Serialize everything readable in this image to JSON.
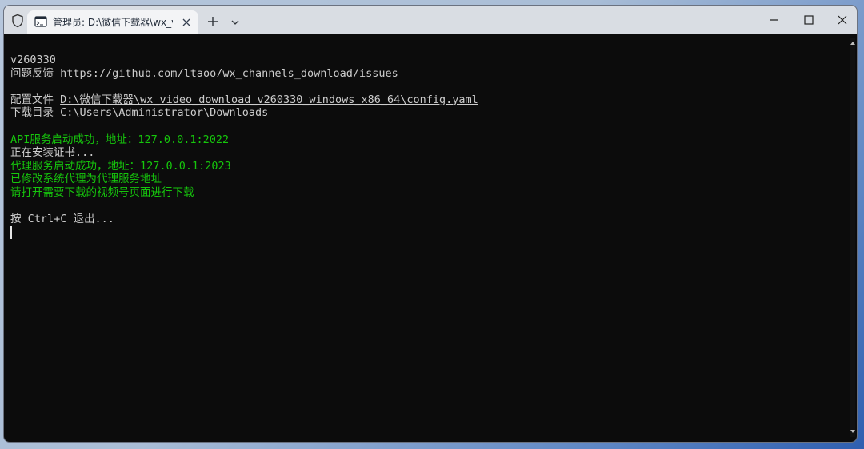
{
  "window": {
    "tab_title": "管理员: D:\\微信下载器\\wx_video",
    "new_tab_symbol": "+",
    "minimize_symbol": "—",
    "maximize_symbol": "▢",
    "close_symbol": "×"
  },
  "console": {
    "version": "v260330",
    "feedback_label": "问题反馈",
    "feedback_url": "https://github.com/ltaoo/wx_channels_download/issues",
    "config_label": "配置文件",
    "config_path": "D:\\微信下载器\\wx_video_download_v260330_windows_x86_64\\config.yaml",
    "download_label": "下载目录",
    "download_path": "C:\\Users\\Administrator\\Downloads",
    "api_started": "API服务启动成功，地址：127.0.0.1:2022",
    "installing_cert": "正在安装证书...",
    "proxy_started": "代理服务启动成功，地址：127.0.0.1:2023",
    "proxy_set": "已修改系统代理为代理服务地址",
    "open_page": "请打开需要下载的视频号页面进行下载",
    "exit_hint": "按 Ctrl+C 退出..."
  },
  "colors": {
    "terminal_bg": "#0c0c0c",
    "text": "#cccccc",
    "success": "#16c60c",
    "titlebar": "#d9dde3"
  },
  "icons": {
    "shield": "shield-icon",
    "terminal_tab": "terminal-icon",
    "close": "close-icon",
    "add": "plus-icon",
    "dropdown": "chevron-down-icon",
    "minimize": "minimize-icon",
    "maximize": "maximize-icon",
    "window_close": "window-close-icon"
  }
}
